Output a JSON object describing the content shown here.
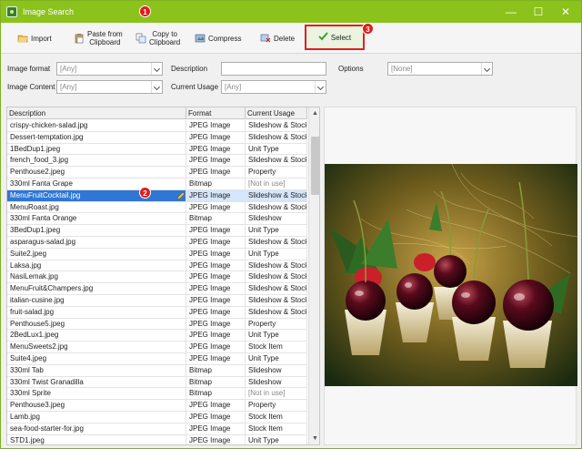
{
  "window": {
    "title": "Image Search",
    "markers": [
      "1",
      "2",
      "3"
    ],
    "controls": [
      "—",
      "☐",
      "✕"
    ]
  },
  "toolbar": {
    "import": "Import",
    "paste_line1": "Paste from",
    "paste_line2": "Clipboard",
    "copy_line1": "Copy to",
    "copy_line2": "Clipboard",
    "compress": "Compress",
    "delete": "Delete",
    "select": "Select"
  },
  "filters": {
    "image_format_label": "Image format",
    "image_format_value": "[Any]",
    "description_label": "Description",
    "description_value": "",
    "options_label": "Options",
    "options_value": "[None]",
    "image_content_label": "Image Content",
    "image_content_value": "[Any]",
    "current_usage_label": "Current Usage",
    "current_usage_value": "[Any]"
  },
  "grid": {
    "columns": [
      "Description",
      "Format",
      "Current Usage"
    ],
    "rows": [
      [
        "crispy-chicken-salad.jpg",
        "JPEG Image",
        "Slideshow & Stock I"
      ],
      [
        "Dessert-temptation.jpg",
        "JPEG Image",
        "Slideshow & Stock I"
      ],
      [
        "1BedDup1.jpeg",
        "JPEG Image",
        "Unit Type"
      ],
      [
        "french_food_3.jpg",
        "JPEG Image",
        "Slideshow & Stock I"
      ],
      [
        "Penthouse2.jpeg",
        "JPEG Image",
        "Property"
      ],
      [
        "330ml Fanta Grape",
        "Bitmap",
        "[Not in use]"
      ],
      [
        "MenuFruitCocktail.jpg",
        "JPEG Image",
        "Slideshow & Stock I"
      ],
      [
        "MenuRoast.jpg",
        "JPEG Image",
        "Slideshow & Stock I"
      ],
      [
        "330ml Fanta Orange",
        "Bitmap",
        "Slideshow"
      ],
      [
        "3BedDup1.jpeg",
        "JPEG Image",
        "Unit Type"
      ],
      [
        "asparagus-salad.jpg",
        "JPEG Image",
        "Slideshow & Stock I"
      ],
      [
        "Suite2.jpeg",
        "JPEG Image",
        "Unit Type"
      ],
      [
        "Laksa.jpg",
        "JPEG Image",
        "Slideshow & Stock I"
      ],
      [
        "NasiLemak.jpg",
        "JPEG Image",
        "Slideshow & Stock I"
      ],
      [
        "MenuFruit&Champers.jpg",
        "JPEG Image",
        "Slideshow & Stock I"
      ],
      [
        "italian-cusine.jpg",
        "JPEG Image",
        "Slideshow & Stock I"
      ],
      [
        "fruit-salad.jpg",
        "JPEG Image",
        "Slideshow & Stock I"
      ],
      [
        "Penthouse5.jpeg",
        "JPEG Image",
        "Property"
      ],
      [
        "2BedLux1.jpeg",
        "JPEG Image",
        "Unit Type"
      ],
      [
        "MenuSweets2.jpg",
        "JPEG Image",
        "Stock Item"
      ],
      [
        "Suite4.jpeg",
        "JPEG Image",
        "Unit Type"
      ],
      [
        "330ml Tab",
        "Bitmap",
        "Slideshow"
      ],
      [
        "330ml Twist Granadilla",
        "Bitmap",
        "Slideshow"
      ],
      [
        "330ml Sprite",
        "Bitmap",
        "[Not in use]"
      ],
      [
        "Penthouse3.jpeg",
        "JPEG Image",
        "Property"
      ],
      [
        "Lamb.jpg",
        "JPEG Image",
        "Stock Item"
      ],
      [
        "sea-food-starter-for.jpg",
        "JPEG Image",
        "Stock Item"
      ],
      [
        "STD1.jpeg",
        "JPEG Image",
        "Unit Type"
      ]
    ],
    "selected_index": 6
  },
  "colors": {
    "titlebar": "#8cc21c",
    "selection": "#3077d4",
    "marker": "#e21b1b",
    "highlight_border": "#e02020"
  }
}
